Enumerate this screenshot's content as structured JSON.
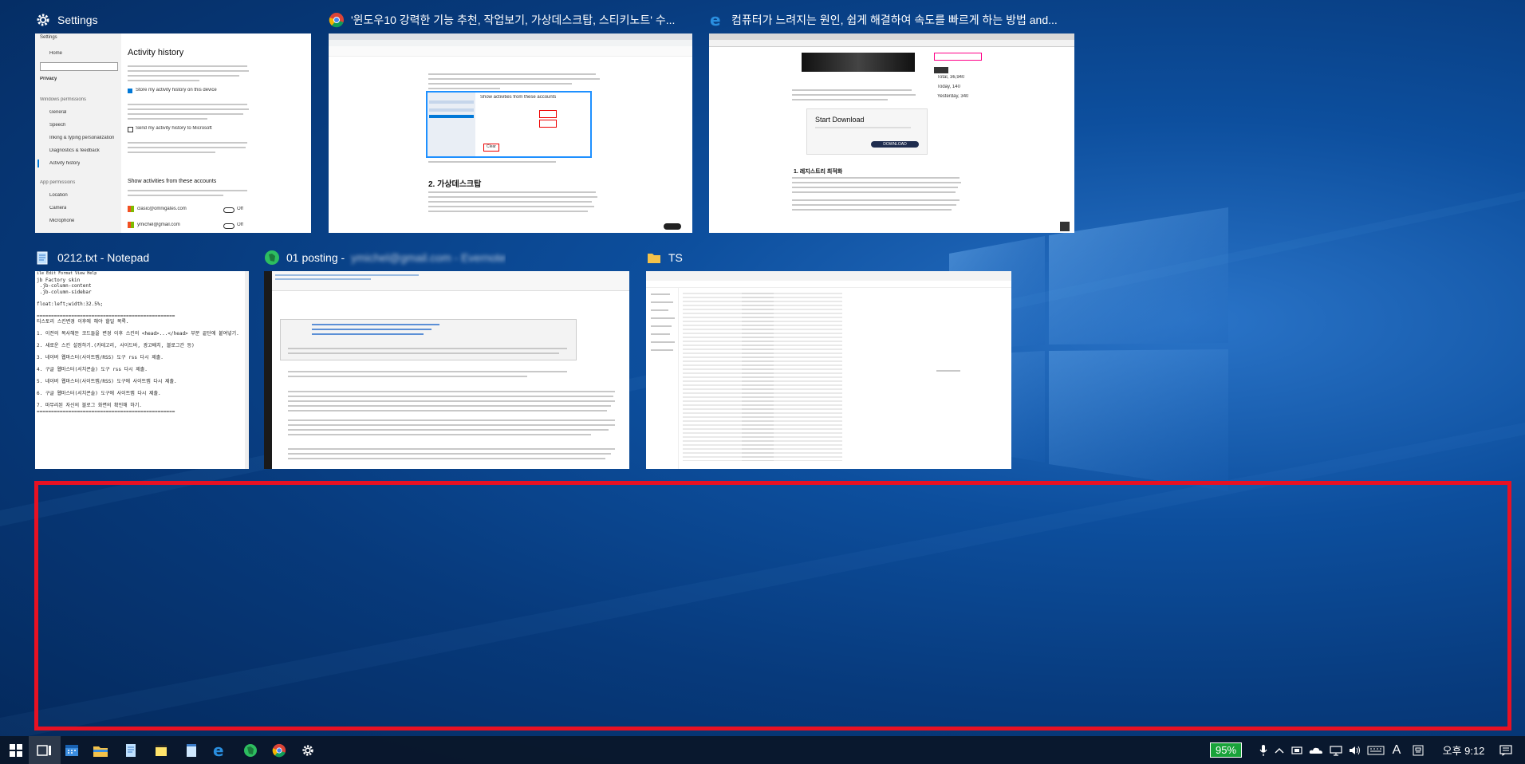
{
  "windows": [
    {
      "title": "Settings",
      "heading": "Activity history",
      "sidebar": [
        "Home",
        "Privacy",
        "Windows permissions",
        "General",
        "Speech",
        "Inking & typing personalization",
        "Diagnostics & feedback",
        "Activity history",
        "App permissions",
        "Location",
        "Camera",
        "Microphone"
      ],
      "check1": "Store my activity history on this device",
      "check2": "Send my activity history to Microsoft",
      "subheading": "Show activities from these accounts",
      "accounts": [
        "clasic@omnigates.com",
        "ymichel@gmail.com"
      ],
      "toggle": "Off"
    },
    {
      "title": "'윈도우10 강력한 기능 추천, 작업보기, 가상데스크탑, 스티키노트' 수...",
      "article_heading": "2. 가상데스크탑",
      "dialog_heading": "Show activities from these accounts",
      "button": "Clear"
    },
    {
      "title": "컴퓨터가 느려지는 원인, 쉽게 해결하여 속도를 빠르게 하는 방법 and...",
      "ad_heading": "Start Download",
      "ad_button": "DOWNLOAD",
      "stats": [
        "Total, 36,940",
        "Today, 140",
        "Yesterday, 340"
      ],
      "section_heading": "1. 레지스트리 최적화"
    },
    {
      "title": "0212.txt - Notepad",
      "lines": [
        "ile Edit Format View Help",
        "jb Factory skin",
        " .jb-column-content",
        " .jb-column-sidebar",
        "",
        "float:left;width:32.5%;",
        "",
        "================================================",
        "티스토리 스킨변경 이후에 해야 할일 목록.",
        "",
        "1. 이전의 복사해둔 코드들을 변경 이후 스킨의 <head>...</head> 부분 끝단에 붙여넣기.",
        "",
        "2. 새로운 스킨 설정하기.(카테고리, 사이드바, 광고배치, 블로그간 등)",
        "",
        "3. 네이버 웹마스터(사이트맵/RSS) 도구 rss 다시 제출.",
        "",
        "4. 구글 웹마스터(서치콘솔) 도구 rss 다시 제출.",
        "",
        "5. 네이버 웹마스터(사이트맵/RSS) 도구에 사이트맵 다시 제출.",
        "",
        "6. 구글 웹마스터(서치콘솔) 도구에 사이트맵 다시 제출.",
        "",
        "7. 마무리된 자신의 블로그 화면의 확인해 하기.",
        "================================================"
      ]
    },
    {
      "title": "01 posting -",
      "blurred": "ymichel@gmail.com - Evernote"
    },
    {
      "title": "TS"
    }
  ],
  "taskbar": {
    "battery": "95%",
    "time": "오후 9:12",
    "ime": "A",
    "apps": [
      "start",
      "task-view",
      "calendar",
      "file-explorer",
      "notepad",
      "sticky-notes",
      "notepad-2",
      "edge",
      "evernote",
      "chrome",
      "settings"
    ]
  },
  "colors": {
    "selection": "#e81123",
    "battery": "#19a33a",
    "accent": "#0078d7"
  }
}
